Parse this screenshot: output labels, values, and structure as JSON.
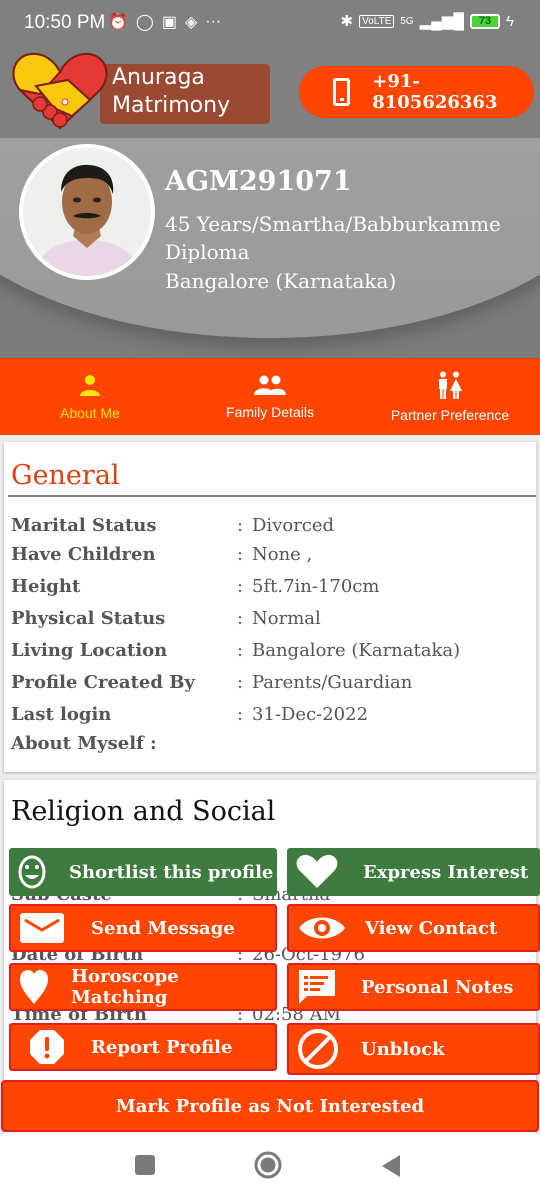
{
  "status_bar": {
    "time": "10:50 PM",
    "left_icons": [
      "alarm-icon",
      "whatsapp-icon",
      "sim-icon",
      "app-icon",
      "more-icon"
    ],
    "more": "···",
    "network": "5G",
    "volte": "VoLTE",
    "battery": "73"
  },
  "header": {
    "brand_line1": "Anuraga",
    "brand_line2": "Matrimony",
    "phone": "+91-8105626363"
  },
  "profile": {
    "id": "AGM291071",
    "line1": "45 Years/Smartha/Babburkamme",
    "line2": "Diploma",
    "line3": "Bangalore (Karnataka)"
  },
  "tabs": [
    {
      "label": "About Me",
      "active": true
    },
    {
      "label": "Family Details",
      "active": false
    },
    {
      "label": "Partner Preference",
      "active": false
    }
  ],
  "general": {
    "title": "General",
    "rows": [
      {
        "label": "Marital Status",
        "value": "Divorced"
      },
      {
        "label": "Have Children",
        "value": "None ,"
      },
      {
        "label": "Height",
        "value": "5ft.7in-170cm"
      },
      {
        "label": "Physical Status",
        "value": "Normal"
      },
      {
        "label": "Living Location",
        "value": "Bangalore (Karnataka)"
      },
      {
        "label": "Profile Created By",
        "value": "Parents/Guardian"
      },
      {
        "label": "Last login",
        "value": "31-Dec-2022"
      }
    ],
    "about_label": "About Myself :"
  },
  "religion": {
    "title": "Religion and Social",
    "rows": [
      {
        "label": "Sub Caste",
        "value": "Smartha"
      },
      {
        "label": "Date of Birth",
        "value": "26-Oct-1976"
      },
      {
        "label": "Time of Birth",
        "value": "02:58 AM"
      }
    ]
  },
  "actions": {
    "shortlist": "Shortlist this profile",
    "express_interest": "Express Interest",
    "send_message": "Send Message",
    "view_contact": "View Contact",
    "horoscope": "Horoscope Matching",
    "notes": "Personal Notes",
    "report": "Report Profile",
    "unblock": "Unblock",
    "not_interested": "Mark Profile as Not Interested"
  },
  "colors": {
    "accent": "#ff4500",
    "green": "#3e7b3e",
    "active_tab": "#ffe600",
    "section_title": "#d84315"
  }
}
